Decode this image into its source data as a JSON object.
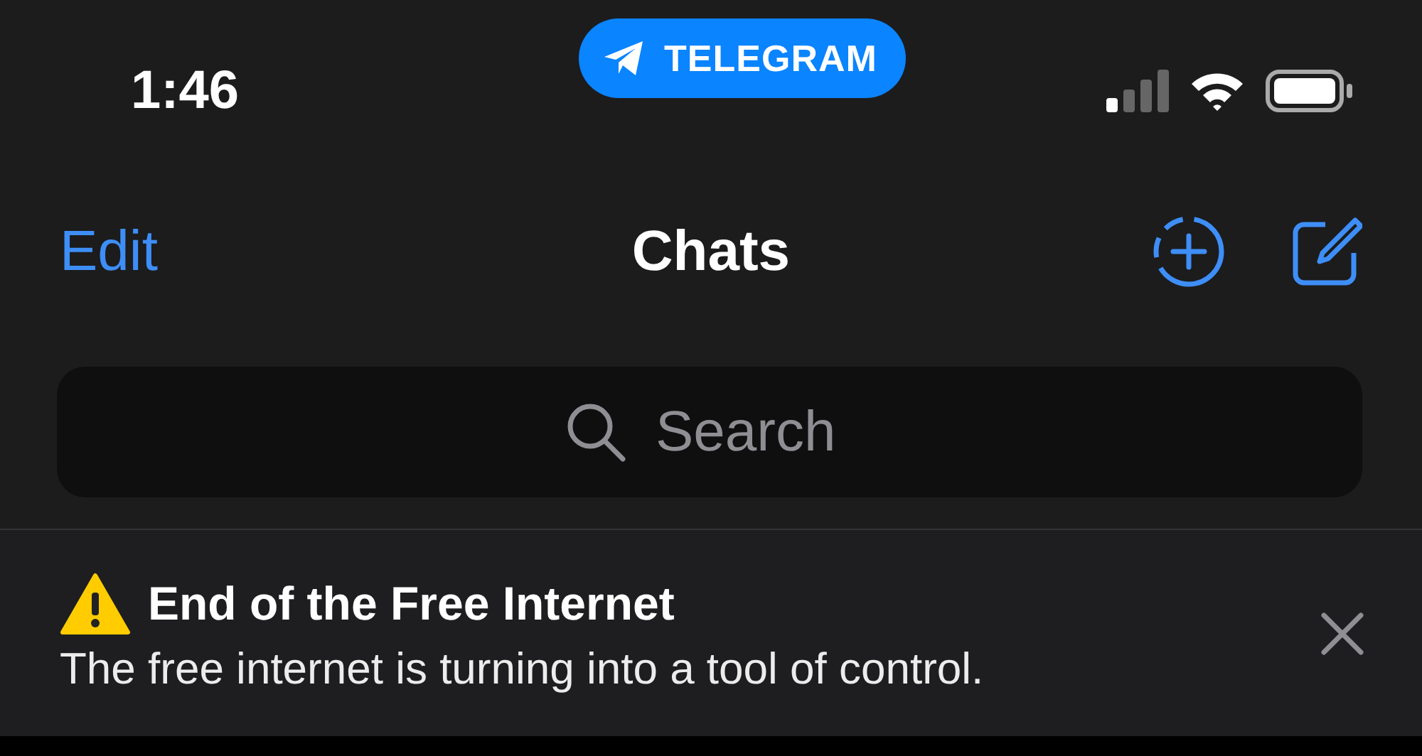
{
  "status_bar": {
    "time": "1:46",
    "app_pill": {
      "label": "TELEGRAM"
    }
  },
  "nav": {
    "left_action": "Edit",
    "title": "Chats"
  },
  "search": {
    "placeholder": "Search"
  },
  "banner": {
    "title": "End of the Free Internet",
    "body": "The free internet is turning into a tool of control."
  }
}
